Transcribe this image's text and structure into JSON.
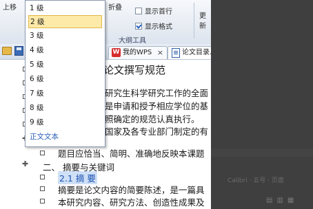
{
  "ribbon": {
    "up_label": "上移",
    "fold_label": "折叠",
    "show_first_row": "显示首行",
    "show_format": "显示格式",
    "show_first_row_checked": false,
    "show_format_checked": true,
    "group_label": "大纲工具",
    "more_label": "更新"
  },
  "dropdown": {
    "items": [
      "1 级",
      "2 级",
      "3 级",
      "4 级",
      "5 级",
      "6 级",
      "7 级",
      "8 级",
      "9 级"
    ],
    "selected": "2 级",
    "body_text": "正文文本"
  },
  "tabs": {
    "wps": "我的WPS",
    "doc": "论文目录.d",
    "close_glyph": "×"
  },
  "document": {
    "title": "论文撰写规范",
    "lines": [
      "研究生科学研究工作的全面",
      "是申请和授予相应学位的基",
      "照确定的规范认真执行。",
      "国家及各专业部门制定的有",
      "题目应恰当、简明、准确地反映本课题",
      "二、  摘要与关键词",
      "2.1 摘    要",
      "摘要是论文内容的简要陈述，是一篇具",
      "本研究内容、研究方法、创造性成果及"
    ]
  },
  "overlay": {
    "status_text": "Calibri · 五号 · 页面"
  }
}
